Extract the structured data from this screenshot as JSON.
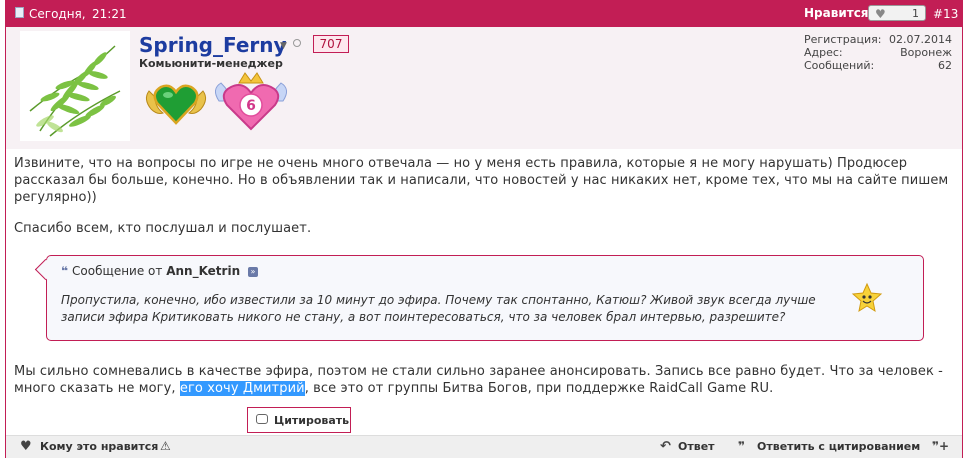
{
  "header": {
    "date": "Сегодня,",
    "time": "21:21",
    "like_label": "Нравится:",
    "like_count": "1",
    "post_number": "#13"
  },
  "user": {
    "name": "Spring_Ferny",
    "reputation": "707",
    "role": "Комьюнити-менеджер",
    "badge2_number": "6"
  },
  "stats": {
    "registration_label": "Регистрация:",
    "registration_value": "02.07.2014",
    "address_label": "Адрес:",
    "address_value": "Воронеж",
    "messages_label": "Сообщений:",
    "messages_value": "62"
  },
  "post": {
    "paragraph1": "Извините, что на вопросы по игре не очень много отвечала — но у меня есть правила, которые я не могу нарушать) Продюсер рассказал бы больше, конечно. Но в объявлении так и написали, что новостей у нас никаких нет, кроме тех, что мы на сайте пишем регулярно))",
    "paragraph2": "Спасибо всем, кто послушал и послушает.",
    "paragraph3_before": "Мы сильно сомневались в качестве эфира, поэтом не стали сильно заранее анонсировать. Запись все равно будет. Что за человек - много сказать не могу, ",
    "paragraph3_highlight": "его хочу Дмитрий",
    "paragraph3_after": ", все это от группы Битва Богов, при поддержке RaidCall Game RU."
  },
  "quote": {
    "prefix": "Сообщение от",
    "author": "Ann_Ketrin",
    "text": "Пропустила, конечно, ибо известили за 10 минут до эфира. Почему так спонтанно, Катюш? Живой звук всегда лучше записи эфира Критиковать никого не стану, а вот поинтересоваться, что за человек брал интервью, разрешите?"
  },
  "cite_button": "Цитировать",
  "footer": {
    "who_likes": "Кому это нравится",
    "reply": "Ответ",
    "reply_quote": "Ответить с цитированием"
  },
  "colors": {
    "accent": "#c21e55",
    "name": "#1d3ca0",
    "highlight": "#3399ff"
  }
}
